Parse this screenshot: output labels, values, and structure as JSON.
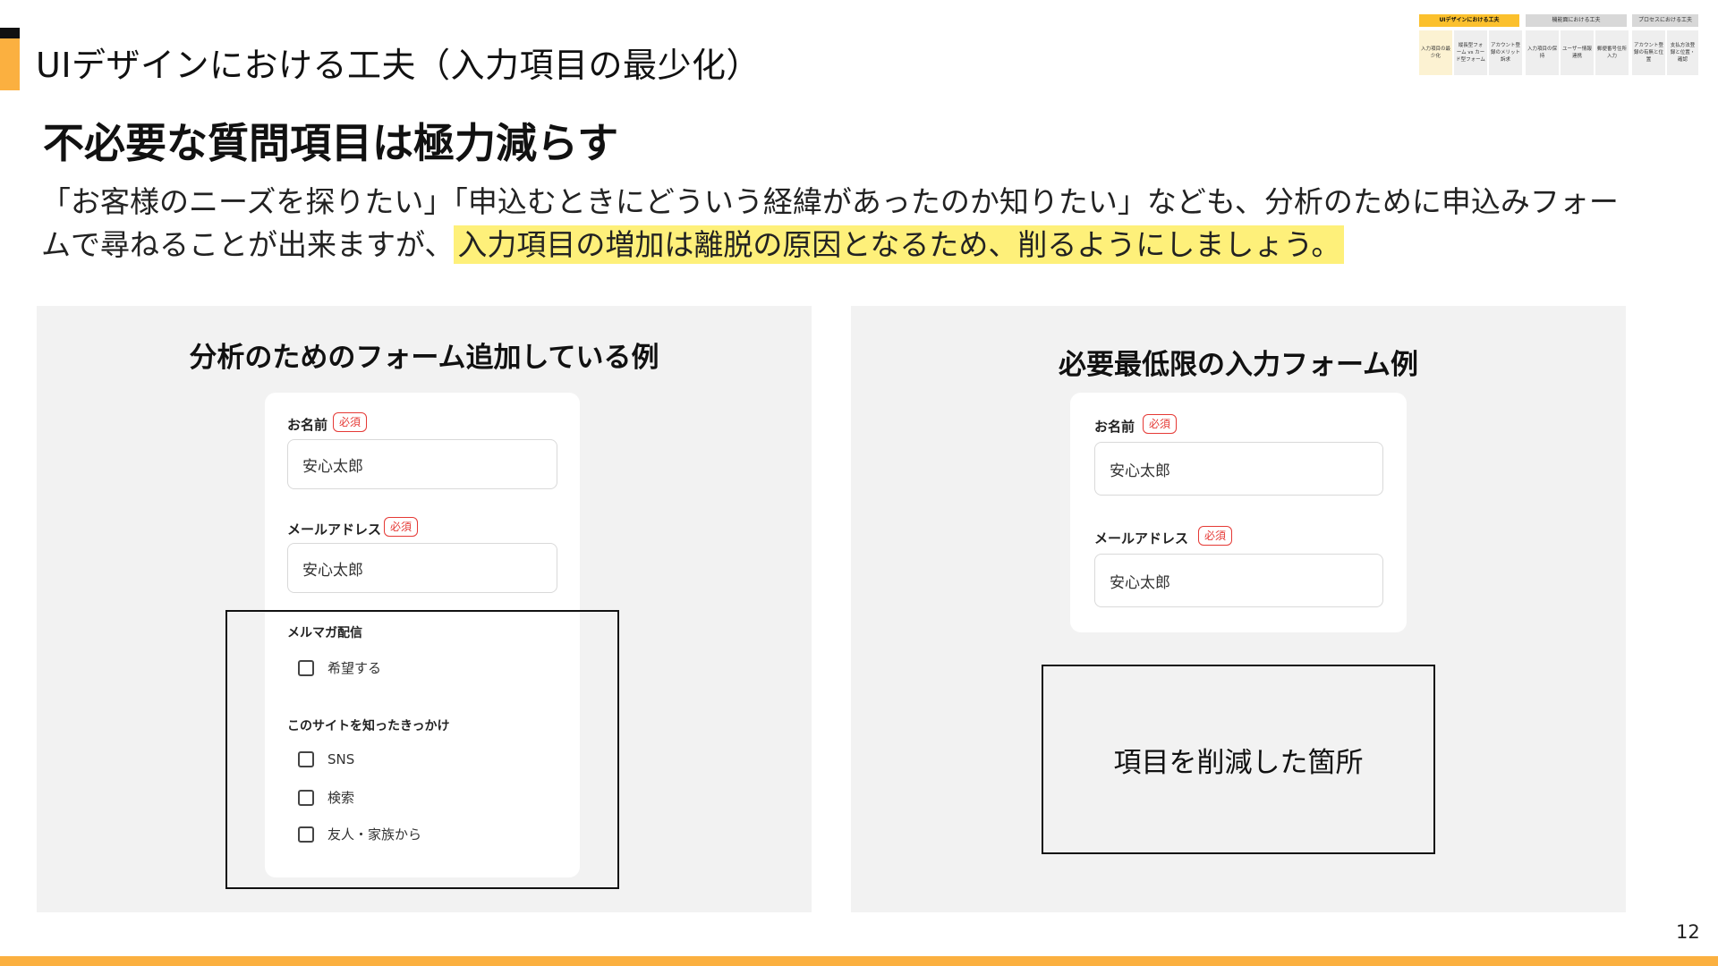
{
  "slide": {
    "title": "UIデザインにおける工夫（入力項目の最少化）",
    "headline": "不必要な質問項目は極力減らす",
    "lead_text": "「お客様のニーズを探りたい」「申込むときにどういう経緯があったのか知りたい」なども、分析のために申込みフォームで尋ねることが出来ますが、",
    "lead_highlight": "入力項目の増加は離脱の原因となるため、削るようにしましょう。",
    "page_number": "12",
    "accent_color": "#FBB040",
    "highlight_color": "#FEF07A"
  },
  "nav_map": {
    "groups": [
      {
        "label": "UIデザインにおける工夫",
        "active": true
      },
      {
        "label": "機能面における工夫",
        "active": false
      },
      {
        "label": "プロセスにおける工夫",
        "active": false
      }
    ],
    "cells": [
      {
        "label": "入力項目の最少化",
        "active": true
      },
      {
        "label": "縦長型フォーム vs カード型フォーム",
        "active": false
      },
      {
        "label": "アカウント登録のメリット訴求",
        "active": false
      },
      {
        "label": "入力項目の保持",
        "active": false
      },
      {
        "label": "ユーザー情報連携",
        "active": false
      },
      {
        "label": "郵便番号住所入力",
        "active": false
      },
      {
        "label": "アカウント登録の有無と位置",
        "active": false
      },
      {
        "label": "支払方法登録と位置・確認",
        "active": false
      }
    ]
  },
  "left_panel": {
    "title": "分析のためのフォーム追加している例",
    "name_label": "お名前",
    "required_badge": "必須",
    "name_value": "安心太郎",
    "email_label": "メールアドレス",
    "email_value": "安心太郎",
    "newsletter_label": "メルマガ配信",
    "newsletter_option": "希望する",
    "source_label": "このサイトを知ったきっかけ",
    "source_options": [
      "SNS",
      "検索",
      "友人・家族から"
    ]
  },
  "right_panel": {
    "title": "必要最低限の入力フォーム例",
    "name_label": "お名前",
    "required_badge": "必須",
    "name_value": "安心太郎",
    "email_label": "メールアドレス",
    "email_value": "安心太郎",
    "removed_note": "項目を削減した箇所"
  }
}
